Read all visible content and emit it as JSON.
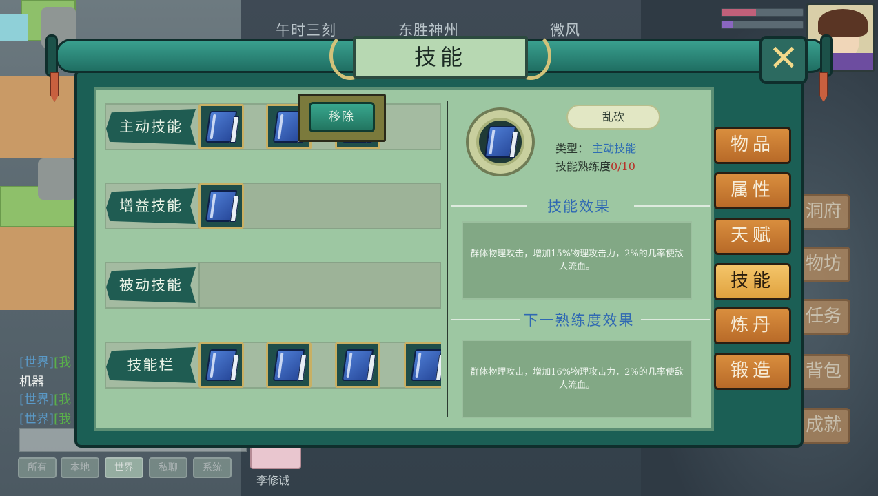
{
  "hud": {
    "time": "午时三刻",
    "region": "东胜神州",
    "weather": "微风"
  },
  "background_menu": [
    "洞府",
    "物坊",
    "任务",
    "背包",
    "成就"
  ],
  "chat": {
    "lines": [
      {
        "channel": "[世界]",
        "prefix": "[我"
      },
      {
        "channel": "机器",
        "prefix": ""
      },
      {
        "channel": "[世界]",
        "prefix": "[我"
      },
      {
        "channel": "[世界]",
        "prefix": "[我"
      }
    ],
    "tabs": [
      "所有",
      "本地",
      "世界",
      "私聊",
      "系统"
    ],
    "active_tab": "世界",
    "player_name": "李修诚"
  },
  "dialog": {
    "title": "技能",
    "close_icon": "close-x-icon",
    "rows": [
      {
        "label": "主动技能",
        "slots": 3
      },
      {
        "label": "增益技能",
        "slots": 1
      },
      {
        "label": "被动技能",
        "slots": 0
      },
      {
        "label": "技能栏",
        "slots": 4
      }
    ],
    "popup_button": "移除",
    "detail": {
      "name": "乱砍",
      "type_label": "类型：",
      "type_value": "主动技能",
      "proficiency_label": "技能熟练度",
      "proficiency_value": "0/10",
      "effect_title": "技能效果",
      "effect_text": "群体物理攻击，增加15%物理攻击力，2%的几率使敌人流血。",
      "next_title": "下一熟练度效果",
      "next_text": "群体物理攻击，增加16%物理攻击力，2%的几率使敌人流血。"
    },
    "side_tabs": [
      "物品",
      "属性",
      "天赋",
      "技能",
      "炼丹",
      "锻造"
    ],
    "active_side_tab": "技能"
  },
  "colors": {
    "frame": "#1b5f55",
    "panel": "#9dc7a2",
    "tab": "#d98e3e",
    "tab_active": "#f4c56a",
    "accent_blue": "#2f6db3"
  }
}
